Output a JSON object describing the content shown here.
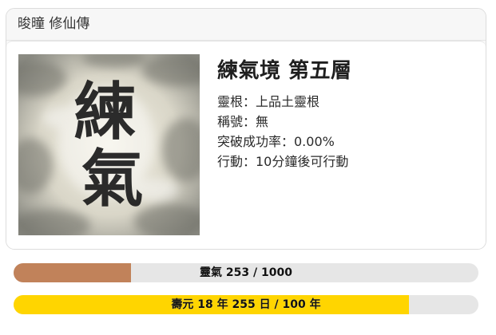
{
  "header": {
    "title": "晙曈 修仙傳"
  },
  "character": {
    "portrait_glyphs": [
      "練",
      "氣"
    ],
    "realm": "練氣境 第五層",
    "stats": [
      "靈根：上品土靈根",
      "稱號：無",
      "突破成功率：0.00%",
      "行動：10分鐘後可行動"
    ]
  },
  "bars": {
    "qi": {
      "label": "靈氣 253 / 1000",
      "current": 253,
      "max": 1000,
      "color": "#c1825a"
    },
    "lifespan": {
      "label": "壽元 18 年 255 日 / 100 年",
      "fraction": 0.85,
      "color": "#ffd500"
    }
  }
}
